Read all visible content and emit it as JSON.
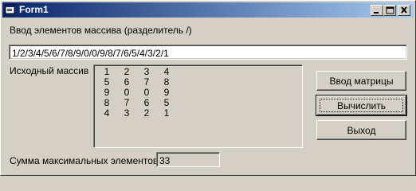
{
  "window": {
    "title": "Form1"
  },
  "input": {
    "label": "Ввод элементов массива (разделитель /)",
    "value": "1/2/3/4/5/6/7/8/9/0/0/9/8/7/6/5/4/3/2/1"
  },
  "matrix": {
    "label": "Исходный массив",
    "rows": [
      [
        "1",
        "2",
        "3",
        "4"
      ],
      [
        "5",
        "6",
        "7",
        "8"
      ],
      [
        "9",
        "0",
        "0",
        "9"
      ],
      [
        "8",
        "7",
        "6",
        "5"
      ],
      [
        "4",
        "3",
        "2",
        "1"
      ]
    ]
  },
  "buttons": {
    "input_matrix": "Ввод матрицы",
    "calculate": "Вычислить",
    "exit": "Выход"
  },
  "result": {
    "label": "Сумма максимальных элементов",
    "value": "33"
  }
}
